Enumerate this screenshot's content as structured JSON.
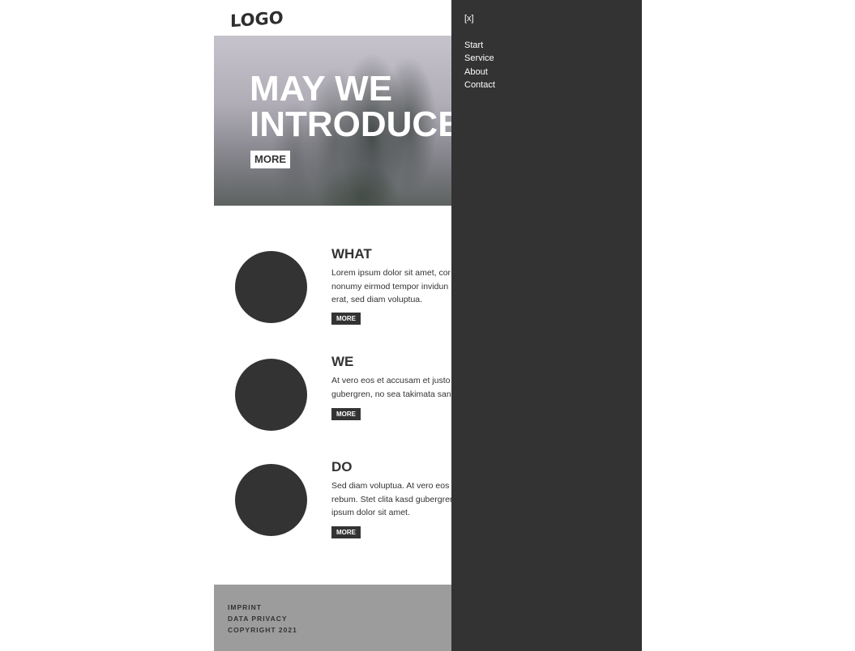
{
  "header": {
    "logo_text": "LOGO"
  },
  "hero": {
    "title_line1": "MAY WE",
    "title_line2": "INTRODUCE",
    "more_label": "MORE"
  },
  "features": [
    {
      "title": "WHAT",
      "lines": [
        "Lorem ipsum dolor sit amet, cor",
        "nonumy eirmod tempor invidun",
        "erat, sed diam voluptua."
      ],
      "more_label": "MORE"
    },
    {
      "title": "WE",
      "lines": [
        "At vero eos et accusam et justo",
        "gubergren, no sea takimata sanc"
      ],
      "more_label": "MORE"
    },
    {
      "title": "DO",
      "lines": [
        "Sed diam voluptua. At vero eos e",
        "rebum. Stet clita kasd gubergren",
        "ipsum dolor sit amet."
      ],
      "more_label": "MORE"
    }
  ],
  "footer": {
    "links": [
      "IMPRINT",
      "DATA PRIVACY",
      "COPYRIGHT 2021"
    ]
  },
  "menu": {
    "close_label": "[x]",
    "items": [
      "Start",
      "Service",
      "About",
      "Contact"
    ]
  },
  "colors": {
    "overlay_bg": "#333333",
    "footer_bg": "#9c9c9c",
    "accent_dark": "#333333"
  }
}
